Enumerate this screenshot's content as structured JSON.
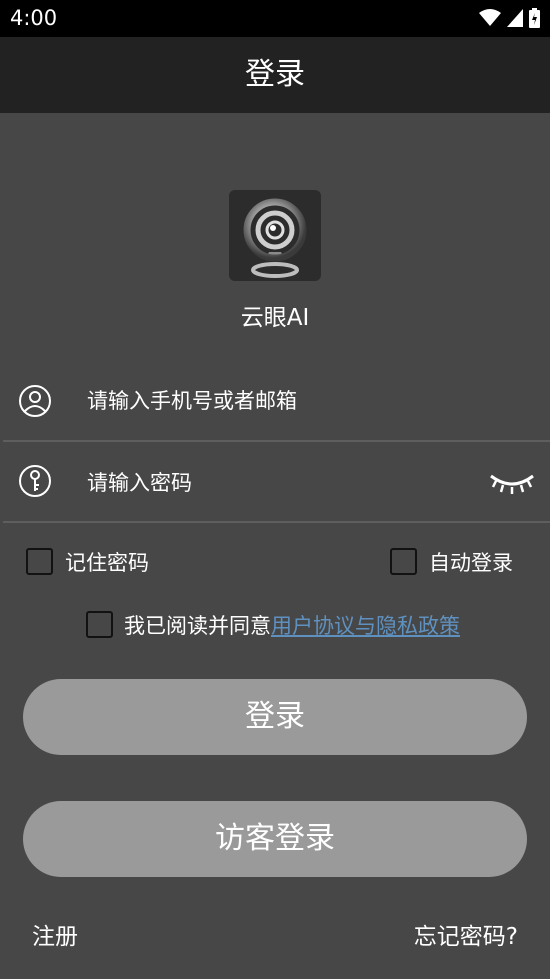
{
  "status_bar": {
    "time": "4:00",
    "icons": [
      "wifi-icon",
      "signal-icon",
      "battery-icon"
    ]
  },
  "header": {
    "title": "登录"
  },
  "app": {
    "name": "云眼AI",
    "logo_icon": "camera-logo-icon"
  },
  "form": {
    "account": {
      "placeholder": "请输入手机号或者邮箱",
      "value": "",
      "icon": "user-icon"
    },
    "password": {
      "placeholder": "请输入密码",
      "value": "",
      "icon": "key-icon",
      "toggle_icon": "eye-closed-icon"
    }
  },
  "options": {
    "remember_password": {
      "label": "记住密码",
      "checked": false
    },
    "auto_login": {
      "label": "自动登录",
      "checked": false
    },
    "agreement": {
      "label_prefix": "我已阅读并同意",
      "link_text": "用户协议与隐私政策",
      "checked": false
    }
  },
  "buttons": {
    "login": "登录",
    "guest_login": "访客登录"
  },
  "footer": {
    "register": "注册",
    "forgot_password": "忘记密码?"
  },
  "colors": {
    "background": "#474747",
    "header": "#222222",
    "button": "#9a9a9a",
    "link": "#5f91c0"
  }
}
